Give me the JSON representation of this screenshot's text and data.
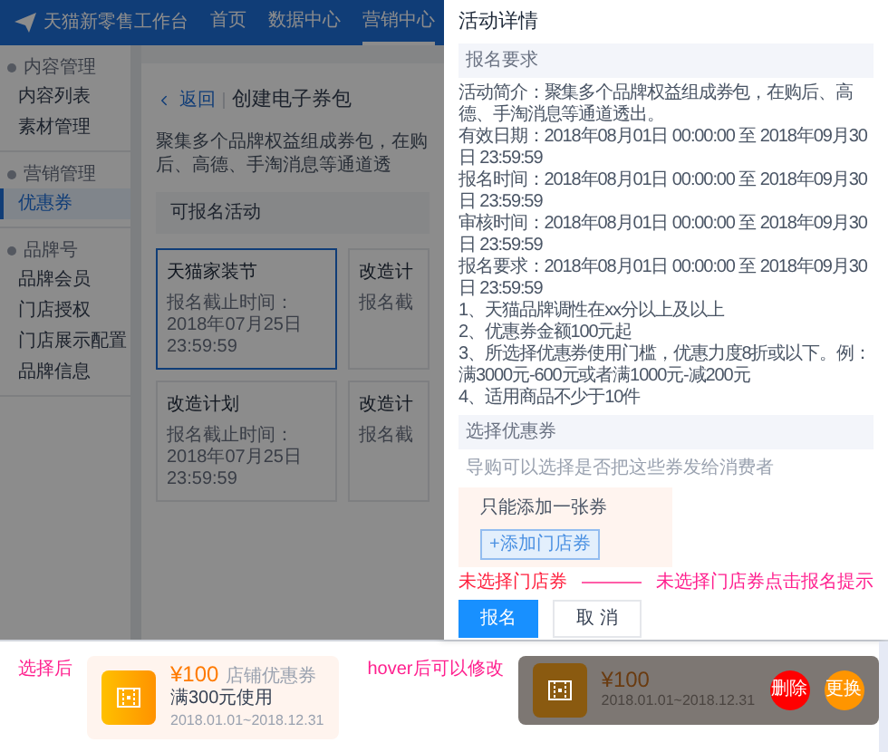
{
  "header": {
    "brand": "天猫新零售工作台",
    "nav": [
      {
        "label": "首页",
        "selected": false
      },
      {
        "label": "数据中心",
        "selected": false
      },
      {
        "label": "营销中心",
        "selected": true
      }
    ]
  },
  "sidebar": [
    {
      "label": "内容管理",
      "children": [
        {
          "label": "内容列表",
          "selected": false
        },
        {
          "label": "素材管理",
          "selected": false
        }
      ]
    },
    {
      "label": "营销管理",
      "children": [
        {
          "label": "优惠券",
          "selected": true
        }
      ]
    },
    {
      "label": "品牌号",
      "children": [
        {
          "label": "品牌会员",
          "selected": false
        },
        {
          "label": "门店授权",
          "selected": false
        },
        {
          "label": "门店展示配置",
          "selected": false
        },
        {
          "label": "品牌信息",
          "selected": false
        }
      ]
    }
  ],
  "page": {
    "back": "返回",
    "title": "创建电子券包",
    "description": "聚集多个品牌权益组成券包，在购后、高德、手淘消息等通道透",
    "section": "可报名活动",
    "cards": [
      {
        "name": "天猫家装节",
        "deadline": "报名截止时间：2018年07月25日 23:59:59",
        "selected": true
      },
      {
        "name": "改造计",
        "deadline": "报名截",
        "selected": false
      },
      {
        "name": "改造计划",
        "deadline": "报名截止时间：2018年07月25日 23:59:59",
        "selected": false
      },
      {
        "name": "改造计",
        "deadline": "报名截",
        "selected": false
      }
    ]
  },
  "drawer": {
    "title": "活动详情",
    "requirements_heading": "报名要求",
    "lines": [
      "活动简介：聚集多个品牌权益组成券包，在购后、高德、手淘消息等通道透出。",
      "有效日期：2018年08月01日 00:00:00  至  2018年09月30日 23:59:59",
      "报名时间：2018年08月01日 00:00:00  至  2018年09月30日 23:59:59",
      "审核时间：2018年08月01日 00:00:00  至  2018年09月30日 23:59:59",
      "报名要求：2018年08月01日 00:00:00  至  2018年09月30日 23:59:59",
      "1、天猫品牌调性在xx分以上及以上",
      "2、优惠券金额100元起",
      "3、所选择优惠券使用门槛，优惠力度8折或以下。例：满3000元-600元或者满1000元-减200元",
      "4、适用商品不少于10件"
    ],
    "coupon_heading": "选择优惠券",
    "coupon_hint": "导购可以选择是否把这些券发给消费者",
    "limit_note": "只能添加一张券",
    "add_button": "+添加门店券",
    "error": "未选择门店券",
    "error_note": "未选择门店券点击报名提示",
    "buttons": [
      {
        "label": "报名",
        "kind": "primary"
      },
      {
        "label": "取 消",
        "kind": "default"
      }
    ]
  },
  "examples": {
    "selected_label": "选择后",
    "coupon": {
      "price": "¥100",
      "type": "店铺优惠券",
      "condition": "满300元使用",
      "dates": "2018.01.01~2018.12.31"
    },
    "hover_label": "hover后可以修改",
    "hover_coupon": {
      "price": "¥100",
      "dates": "2018.01.01~2018.12.31",
      "actions": [
        {
          "label": "删除",
          "kind": "delete"
        },
        {
          "label": "更换",
          "kind": "replace"
        }
      ]
    }
  }
}
